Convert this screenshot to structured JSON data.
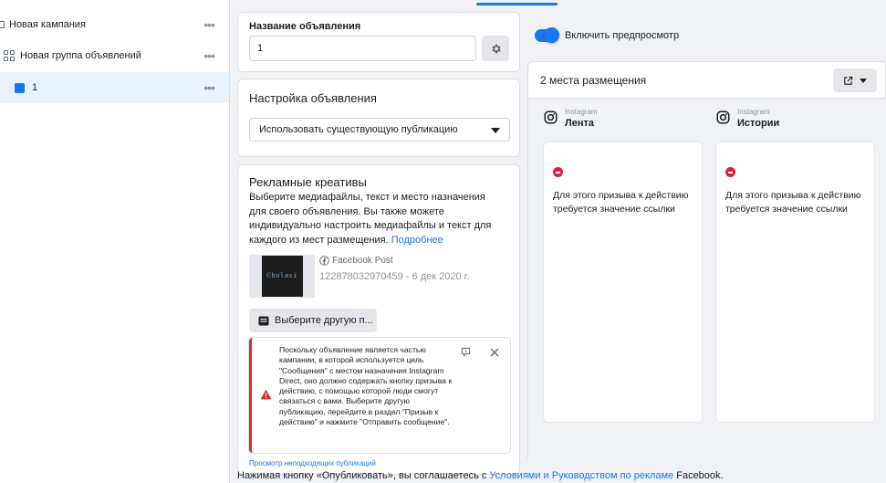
{
  "tree": {
    "campaign": "Новая кампания",
    "adset": "Новая группа объявлений",
    "ad": "1",
    "more": "•••"
  },
  "ad_name": {
    "label": "Название объявления",
    "value": "1"
  },
  "ad_setup": {
    "title": "Настройка объявления",
    "selected": "Использовать существующую публикацию"
  },
  "creatives": {
    "title": "Рекламные креативы",
    "description": "Выберите медиафайлы, текст и место назначения для своего объявления. Вы также можете индивидуально настроить медиафайлы и текст для каждого из мест размещения.",
    "more_link": "Подробнее",
    "post_type": "Facebook Post",
    "post_id": "122878032970459 - 6 дек 2020 г.",
    "thumb_text": "ඞbolasi",
    "choose_button": "Выберите другую п...",
    "warning": "Поскольку объявление является частью кампании, в которой используется цель \"Сообщения\" с местом назначения Instagram Direct, оно должно содержать кнопку призыва к действию, с помощью которой люди смогут связаться с вами. Выберите другую публикацию, перейдите в раздел \"Призыв к действию\" и нажмите \"Отправить сообщение\".",
    "cut_link": "Просмотр неподходящих публикаций"
  },
  "preview": {
    "toggle_label": "Включить предпросмотр",
    "toggle_on": true,
    "placements_title": "2 места размещения",
    "placements": [
      {
        "platform": "Instagram",
        "name": "Лента",
        "error": "Для этого призыва к действию требуется значение ссылки"
      },
      {
        "platform": "Instagram",
        "name": "Истории",
        "error": "Для этого призыва к действию требуется значение ссылки"
      }
    ]
  },
  "footer": {
    "prefix": "Нажимая кнопку «Опубликовать», вы соглашаетесь с ",
    "link": "Условиями и Руководством по рекламе",
    "suffix": " Facebook."
  },
  "colors": {
    "accent": "#1877f2",
    "error": "#e41e3f",
    "background": "#f0f2f5"
  }
}
